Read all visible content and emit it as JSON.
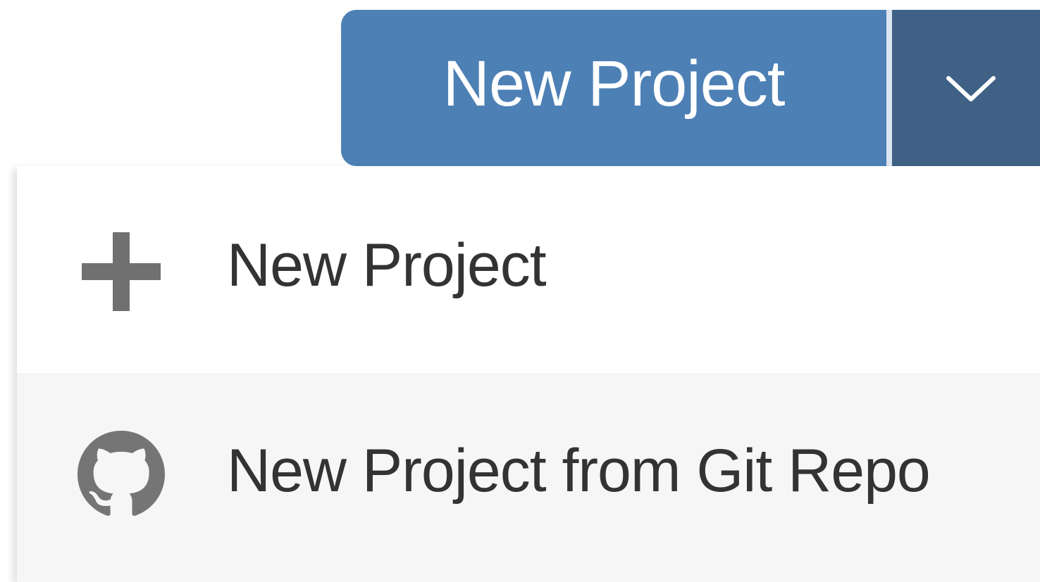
{
  "split_button": {
    "label": "New Project",
    "toggle_icon": "chevron-down-icon",
    "color_main": "#4d80b5",
    "color_toggle": "#3e6185"
  },
  "dropdown": {
    "items": [
      {
        "label": "New Project",
        "icon": "plus-icon"
      },
      {
        "label": "New Project from Git Repo",
        "icon": "github-icon"
      }
    ]
  }
}
